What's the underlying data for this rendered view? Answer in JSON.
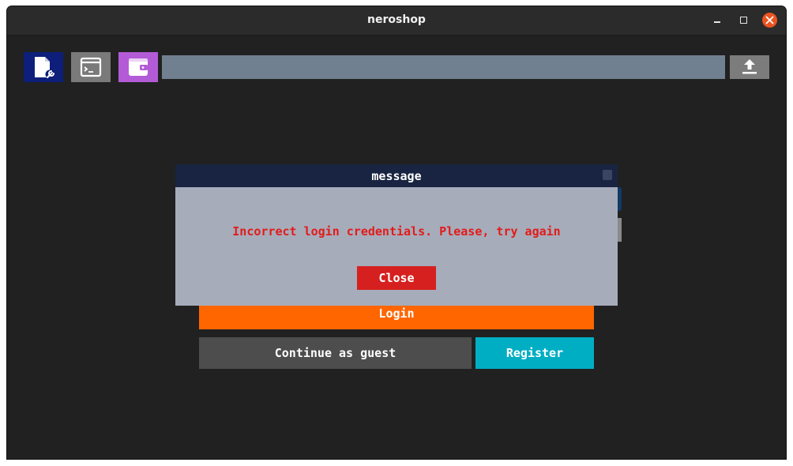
{
  "window": {
    "title": "neroshop",
    "controls": {
      "minimize": "minimize-icon",
      "maximize": "maximize-icon",
      "close": "close-icon"
    }
  },
  "toolbar": {
    "buttons": [
      {
        "icon": "file-settings-icon",
        "color": "#0d1f7a"
      },
      {
        "icon": "terminal-icon",
        "color": "#7a7a7a"
      },
      {
        "icon": "wallet-icon",
        "color": "#b35bd6"
      }
    ],
    "address_value": "",
    "upload_icon": "upload-icon",
    "address_color": "#708090"
  },
  "login": {
    "login_label": "Login",
    "guest_label": "Continue as guest",
    "register_label": "Register",
    "colors": {
      "login": "#ff6600",
      "guest": "#4d4d4d",
      "register": "#00aec3"
    }
  },
  "modal": {
    "title": "message",
    "message": "Incorrect login credentials. Please, try again",
    "close_label": "Close",
    "colors": {
      "header": "#182441",
      "body": "#a6acba",
      "message": "#e31b1b",
      "button": "#d62020"
    }
  }
}
